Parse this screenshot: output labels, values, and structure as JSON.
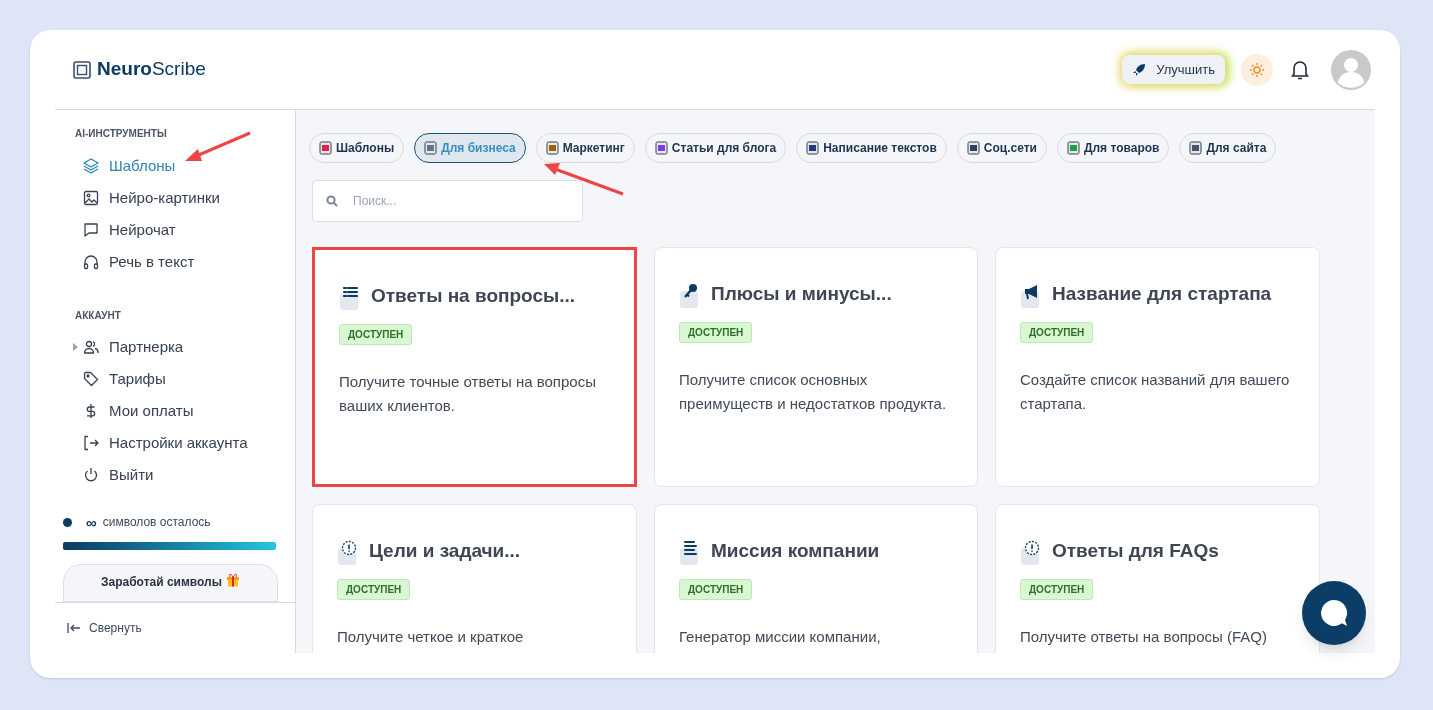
{
  "logo": {
    "bold": "Neuro",
    "light": "Scribe"
  },
  "header": {
    "upgrade_label": "Улучшить"
  },
  "sidebar": {
    "sections": [
      {
        "title": "AI-ИНСТРУМЕНТЫ",
        "items": [
          {
            "label": "Шаблоны",
            "kind": "layers",
            "selected": true,
            "expandable": false
          },
          {
            "label": "Нейро-картинки",
            "kind": "image",
            "selected": false,
            "expandable": false
          },
          {
            "label": "Нейрочат",
            "kind": "chat",
            "selected": false,
            "expandable": false
          },
          {
            "label": "Речь в текст",
            "kind": "headphones",
            "selected": false,
            "expandable": false
          }
        ]
      },
      {
        "title": "АККАУНТ",
        "items": [
          {
            "label": "Партнерка",
            "kind": "users",
            "selected": false,
            "expandable": true
          },
          {
            "label": "Тарифы",
            "kind": "tag",
            "selected": false,
            "expandable": false
          },
          {
            "label": "Мои оплаты",
            "kind": "dollar",
            "selected": false,
            "expandable": false
          },
          {
            "label": "Настройки аккаунта",
            "kind": "logout",
            "selected": false,
            "expandable": false
          },
          {
            "label": "Выйти",
            "kind": "power",
            "selected": false,
            "expandable": false
          }
        ]
      }
    ],
    "credits": {
      "amount": "∞",
      "text": "символов осталось",
      "level": 1
    },
    "earn_button": "Заработай символы",
    "collapse": "Свернуть"
  },
  "categories": [
    {
      "label": "Шаблоны",
      "selected": false
    },
    {
      "label": "Для бизнеса",
      "selected": true
    },
    {
      "label": "Маркетинг",
      "selected": false
    },
    {
      "label": "Статьи для блога",
      "selected": false
    },
    {
      "label": "Написание текстов",
      "selected": false
    },
    {
      "label": "Соц.сети",
      "selected": false
    },
    {
      "label": "Для товаров",
      "selected": false
    },
    {
      "label": "Для сайта",
      "selected": false
    }
  ],
  "search": {
    "placeholder": "Поиск..."
  },
  "templates": [
    {
      "title": "Ответы на вопросы...",
      "kind": "list",
      "badge": "ДОСТУПЕН",
      "description": "Получите точные ответы на вопросы ваших клиентов.",
      "highlighted": true
    },
    {
      "title": "Плюсы и минусы...",
      "kind": "key",
      "badge": "ДОСТУПЕН",
      "description": "Получите список основных преимуществ и недостатков продукта.",
      "highlighted": false
    },
    {
      "title": "Название для стартапа",
      "kind": "megaphone",
      "badge": "ДОСТУПЕН",
      "description": "Создайте список названий для вашего стартапа.",
      "highlighted": false
    },
    {
      "title": "Цели и задачи...",
      "kind": "alert",
      "badge": "ДОСТУПЕН",
      "description": "Получите четкое и краткое",
      "highlighted": false
    },
    {
      "title": "Миссия компании",
      "kind": "lines",
      "badge": "ДОСТУПЕН",
      "description": "Генератор миссии компании,",
      "highlighted": false
    },
    {
      "title": "Ответы для FAQs",
      "kind": "alert",
      "badge": "ДОСТУПЕН",
      "description": "Получите ответы на вопросы (FAQ)",
      "highlighted": false
    }
  ]
}
